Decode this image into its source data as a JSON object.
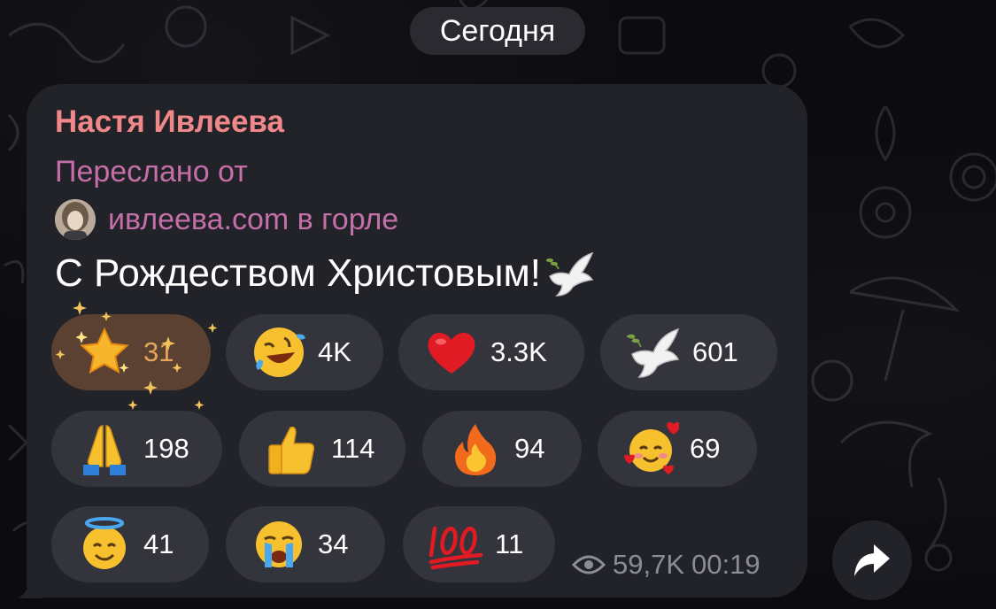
{
  "date_separator": "Сегодня",
  "message": {
    "sender": "Настя Ивлеева",
    "forwarded_label": "Переслано от",
    "forwarded_from": "ивлеева.com в горле",
    "text": "С Рождеством Христовым!",
    "views": "59,7K",
    "time": "00:19"
  },
  "reactions": [
    {
      "emoji": "star-icon",
      "count": "31",
      "selected": true
    },
    {
      "emoji": "rolling-laughing-icon",
      "count": "4K"
    },
    {
      "emoji": "red-heart-icon",
      "count": "3.3K"
    },
    {
      "emoji": "dove-icon",
      "count": "601"
    },
    {
      "emoji": "folded-hands-icon",
      "count": "198"
    },
    {
      "emoji": "thumbs-up-icon",
      "count": "114"
    },
    {
      "emoji": "fire-icon",
      "count": "94"
    },
    {
      "emoji": "smiling-hearts-icon",
      "count": "69"
    },
    {
      "emoji": "halo-icon",
      "count": "41"
    },
    {
      "emoji": "crying-icon",
      "count": "34"
    },
    {
      "emoji": "hundred-points-icon",
      "count": "11"
    }
  ],
  "colors": {
    "sender": "#f0888a",
    "forward": "#c46fa8",
    "bubble": "#222229",
    "reaction_bg": "#34343c",
    "selected_reaction_bg": "#5a4131"
  }
}
